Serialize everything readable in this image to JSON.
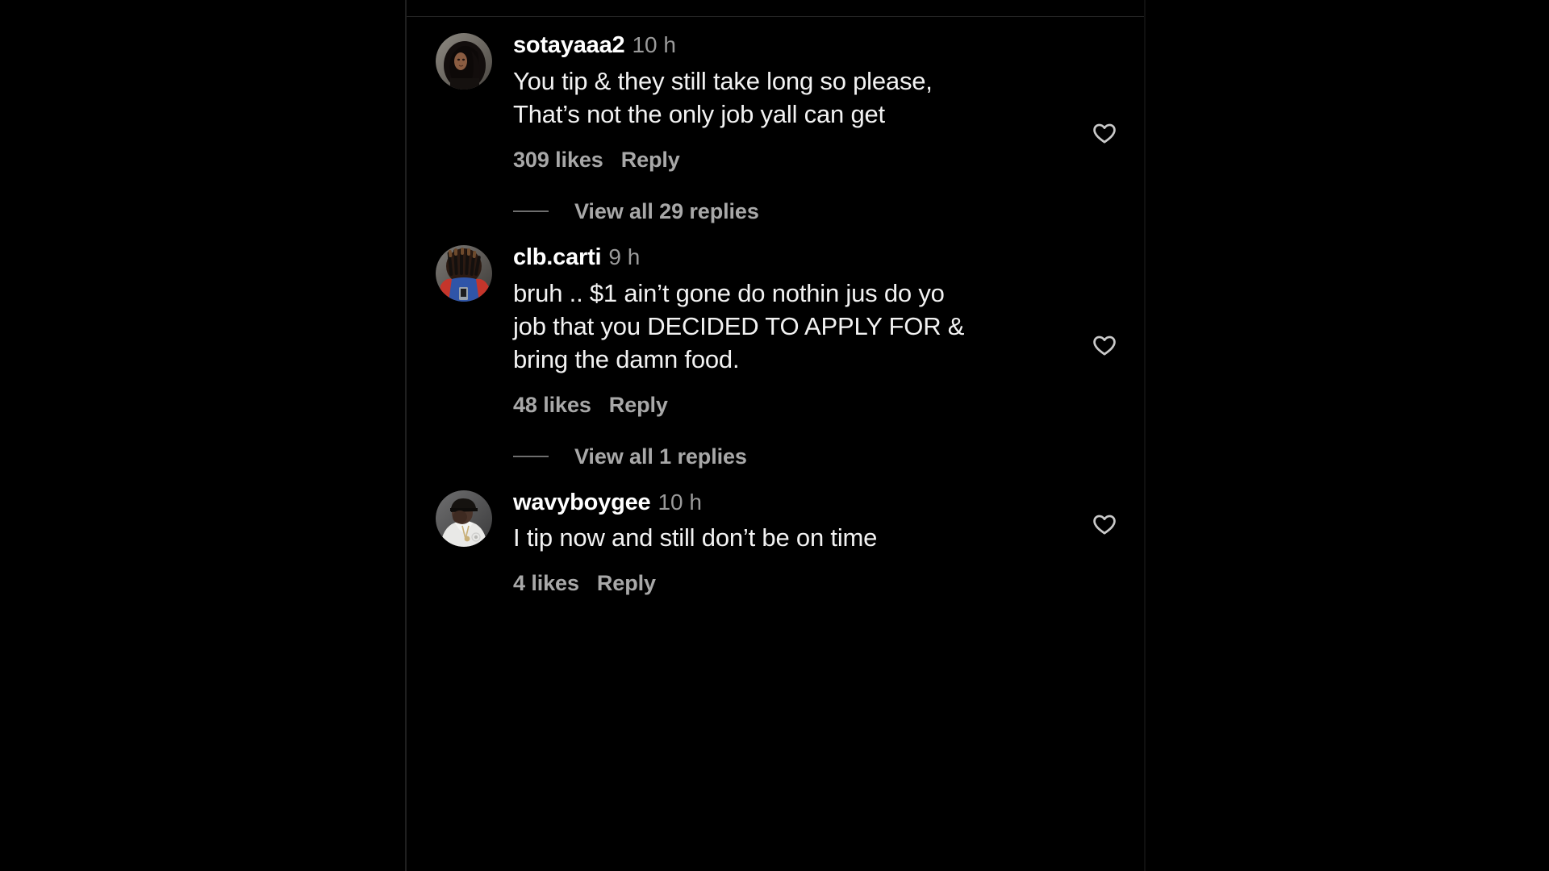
{
  "app": {
    "surface": "instagram-comments",
    "background_color": "#000000",
    "text_color": "#f2f2f2",
    "muted_text_color": "#a8a8a8"
  },
  "scrollbar": {
    "thumb_color": "#3a3a3a",
    "position": "right"
  },
  "comments": [
    {
      "username": "sotayaaa2",
      "timestamp": "10 h",
      "text": "You tip & they still take long so please, That’s not the only job yall can get",
      "likes_label": "309 likes",
      "reply_label": "Reply",
      "like_icon": "heart-outline-icon",
      "replies_label": "View all 29 replies",
      "avatar_alt": "sotayaaa2-avatar"
    },
    {
      "username": "clb.carti",
      "timestamp": "9 h",
      "text": "bruh .. $1 ain’t gone do nothin jus do yo job that you DECIDED TO APPLY FOR & bring the damn food.",
      "likes_label": "48 likes",
      "reply_label": "Reply",
      "like_icon": "heart-outline-icon",
      "replies_label": "View all 1 replies",
      "avatar_alt": "clb.carti-avatar"
    },
    {
      "username": "wavyboygee",
      "timestamp": "10 h",
      "text": "I tip now and still don’t be on time",
      "likes_label": "4 likes",
      "reply_label": "Reply",
      "like_icon": "heart-outline-icon",
      "replies_label": null,
      "avatar_alt": "wavyboygee-avatar"
    }
  ]
}
